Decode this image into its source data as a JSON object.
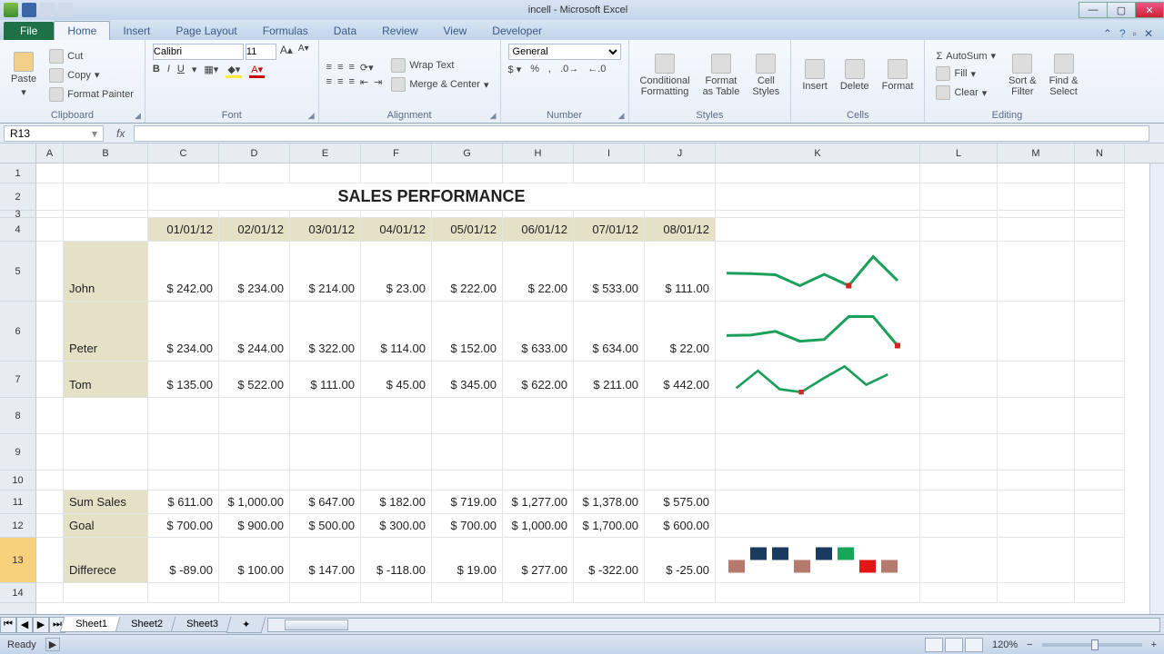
{
  "window": {
    "title": "incell - Microsoft Excel"
  },
  "tabs": {
    "file": "File",
    "home": "Home",
    "insert": "Insert",
    "page_layout": "Page Layout",
    "formulas": "Formulas",
    "data": "Data",
    "review": "Review",
    "view": "View",
    "developer": "Developer"
  },
  "ribbon": {
    "clipboard": {
      "paste": "Paste",
      "cut": "Cut",
      "copy": "Copy",
      "format_painter": "Format Painter",
      "label": "Clipboard"
    },
    "font": {
      "name": "Calibri",
      "size": "11",
      "label": "Font"
    },
    "alignment": {
      "wrap": "Wrap Text",
      "merge": "Merge & Center",
      "label": "Alignment"
    },
    "number": {
      "format": "General",
      "label": "Number"
    },
    "styles": {
      "cond": "Conditional\nFormatting",
      "table": "Format\nas Table",
      "cell": "Cell\nStyles",
      "label": "Styles"
    },
    "cells": {
      "insert": "Insert",
      "delete": "Delete",
      "format": "Format",
      "label": "Cells"
    },
    "editing": {
      "autosum": "AutoSum",
      "fill": "Fill",
      "clear": "Clear",
      "sort": "Sort &\nFilter",
      "find": "Find &\nSelect",
      "label": "Editing"
    }
  },
  "namebox": "R13",
  "columns": [
    "A",
    "B",
    "C",
    "D",
    "E",
    "F",
    "G",
    "H",
    "I",
    "J",
    "K",
    "L",
    "M",
    "N"
  ],
  "sheet": {
    "title": "SALES PERFORMANCE",
    "dates": [
      "01/01/12",
      "02/01/12",
      "03/01/12",
      "04/01/12",
      "05/01/12",
      "06/01/12",
      "07/01/12",
      "08/01/12"
    ],
    "people": [
      {
        "name": "John",
        "vals": [
          "$ 242.00",
          "$  234.00",
          "$ 214.00",
          "$   23.00",
          "$ 222.00",
          "$    22.00",
          "$  533.00",
          "$ 111.00"
        ]
      },
      {
        "name": "Peter",
        "vals": [
          "$ 234.00",
          "$  244.00",
          "$ 322.00",
          "$  114.00",
          "$ 152.00",
          "$   633.00",
          "$  634.00",
          "$  22.00"
        ]
      },
      {
        "name": "Tom",
        "vals": [
          "$ 135.00",
          "$  522.00",
          "$ 111.00",
          "$   45.00",
          "$ 345.00",
          "$   622.00",
          "$  211.00",
          "$ 442.00"
        ]
      }
    ],
    "sum_label": "Sum Sales",
    "sum": [
      "$ 611.00",
      "$ 1,000.00",
      "$ 647.00",
      "$  182.00",
      "$ 719.00",
      "$ 1,277.00",
      "$ 1,378.00",
      "$ 575.00"
    ],
    "goal_label": "Goal",
    "goal": [
      "$ 700.00",
      "$  900.00",
      "$ 500.00",
      "$  300.00",
      "$ 700.00",
      "$ 1,000.00",
      "$ 1,700.00",
      "$ 600.00"
    ],
    "diff_label": "Differece",
    "diff": [
      "$ -89.00",
      "$  100.00",
      "$ 147.00",
      "$ -118.00",
      "$  19.00",
      "$   277.00",
      "$ -322.00",
      "$ -25.00"
    ]
  },
  "sheet_tabs": [
    "Sheet1",
    "Sheet2",
    "Sheet3"
  ],
  "status": {
    "ready": "Ready",
    "zoom": "120%"
  },
  "chart_data": [
    {
      "type": "line",
      "title": "John sparkline",
      "x": [
        1,
        2,
        3,
        4,
        5,
        6,
        7,
        8
      ],
      "values": [
        242,
        234,
        214,
        23,
        222,
        22,
        533,
        111
      ],
      "low_index": 5
    },
    {
      "type": "line",
      "title": "Peter sparkline",
      "x": [
        1,
        2,
        3,
        4,
        5,
        6,
        7,
        8
      ],
      "values": [
        234,
        244,
        322,
        114,
        152,
        633,
        634,
        22
      ],
      "low_index": 7
    },
    {
      "type": "line",
      "title": "Tom sparkline",
      "x": [
        1,
        2,
        3,
        4,
        5,
        6,
        7,
        8
      ],
      "values": [
        135,
        522,
        111,
        45,
        345,
        622,
        211,
        442
      ],
      "low_index": 3
    },
    {
      "type": "bar",
      "title": "Difference win/loss",
      "categories": [
        1,
        2,
        3,
        4,
        5,
        6,
        7,
        8
      ],
      "values": [
        -89,
        100,
        147,
        -118,
        19,
        277,
        -322,
        -25
      ]
    }
  ]
}
